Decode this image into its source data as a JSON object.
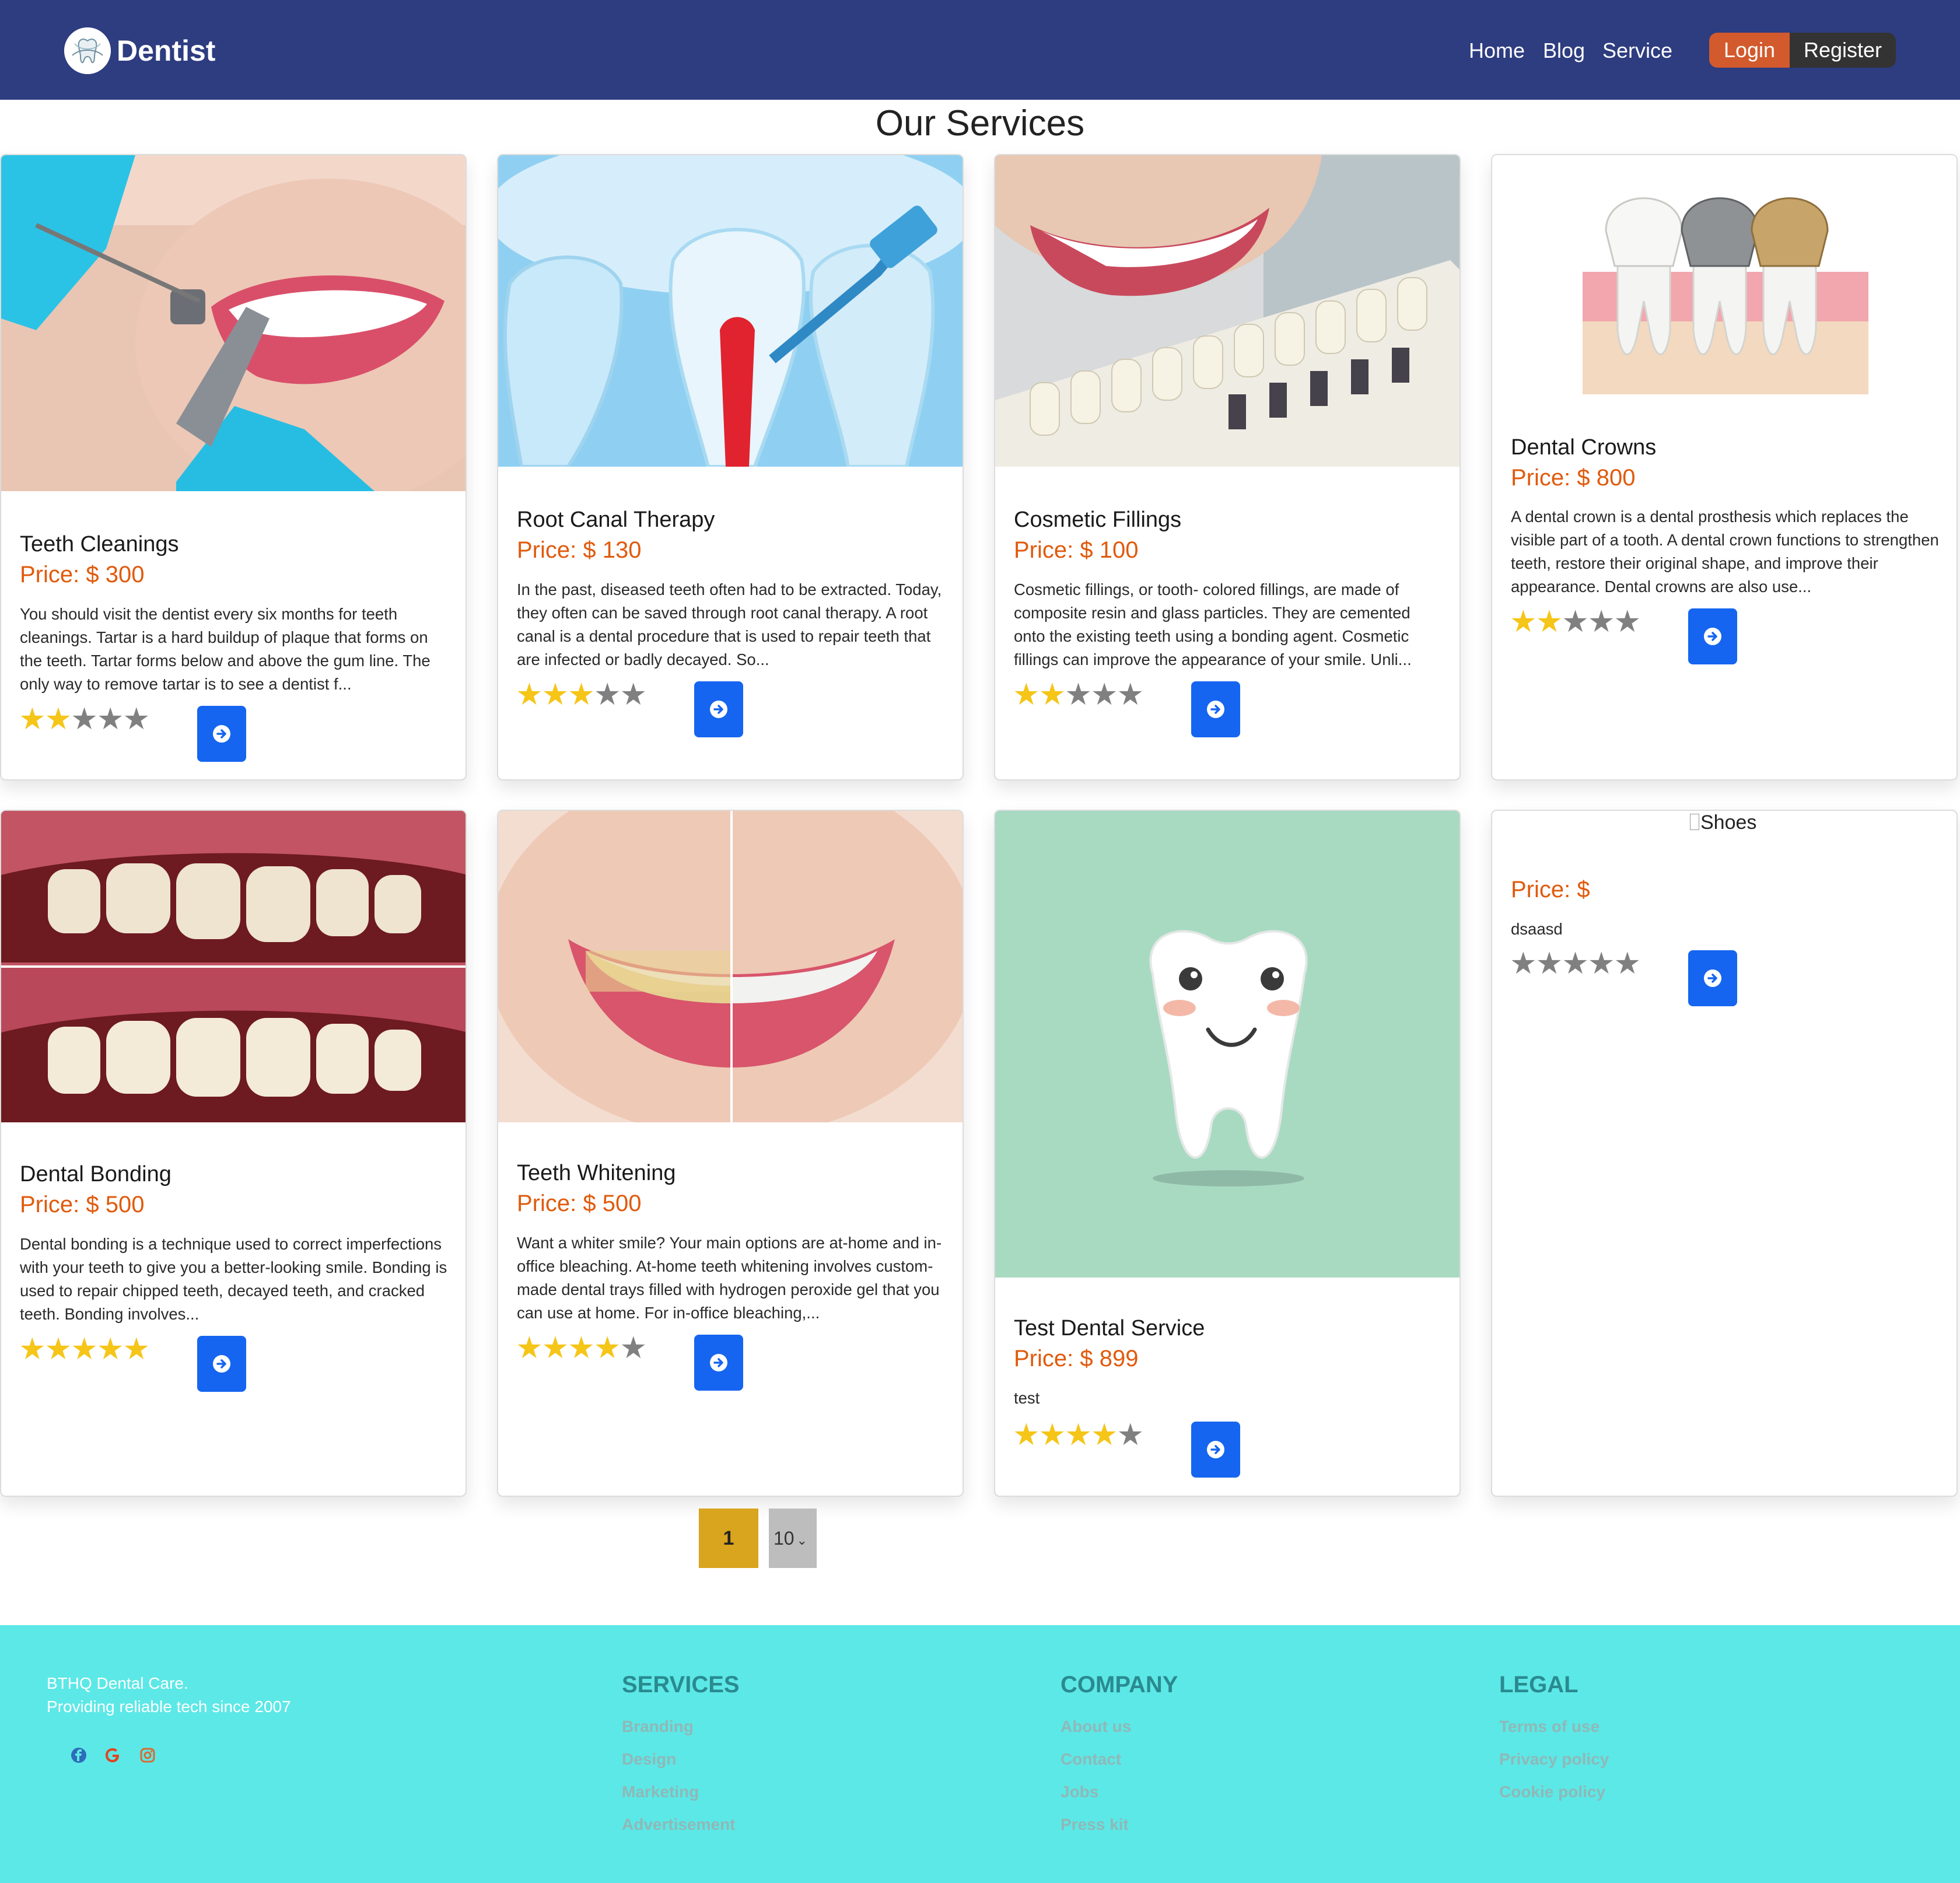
{
  "nav": {
    "brand": "Dentist",
    "links": [
      "Home",
      "Blog",
      "Service"
    ],
    "login": "Login",
    "register": "Register"
  },
  "page_title": "Our Services",
  "cards": [
    {
      "title": "Teeth Cleanings",
      "price": "Price: $ 300",
      "desc": "You should visit the dentist every six months for teeth cleanings. Tartar is a hard buildup of plaque that forms on the teeth. Tartar forms below and above the gum line. The only way to remove tartar is to see a dentist f...",
      "rating": 2,
      "image": "woman smiling during dental cleaning with blue gloves"
    },
    {
      "title": "Root Canal Therapy",
      "price": "Price: $ 130",
      "desc": "In the past, diseased teeth often had to be extracted. Today, they often can be saved through root canal therapy. A root canal is a dental procedure that is used to repair teeth that are infected or badly decayed. So...",
      "rating": 3,
      "image": "blue illustration of root canal treatment"
    },
    {
      "title": "Cosmetic Fillings",
      "price": "Price: $ 100",
      "desc": "Cosmetic fillings, or tooth- colored fillings, are made of composite resin and glass particles. They are cemented onto the existing teeth using a bonding agent. Cosmetic fillings can improve the appearance of your smile. Unli...",
      "rating": 2,
      "image": "smile with tooth shade guide"
    },
    {
      "title": "Dental Crowns",
      "price": "Price: $ 800",
      "desc": "A dental crown is a dental prosthesis which replaces the visible part of a tooth. A dental crown functions to strengthen teeth, restore their original shape, and improve their appearance. Dental crowns are also use...",
      "rating": 2,
      "image": "three dental crowns white silver gold"
    },
    {
      "title": "Dental Bonding",
      "price": "Price: $ 500",
      "desc": "Dental bonding is a technique used to correct imperfections with your teeth to give you a better-looking smile. Bonding is used to repair chipped teeth, decayed teeth, and cracked teeth. Bonding involves...",
      "rating": 5,
      "image": "before and after dental bonding"
    },
    {
      "title": "Teeth Whitening",
      "price": "Price: $ 500",
      "desc": "Want a whiter smile? Your main options are at-home and in-office bleaching. At-home teeth whitening involves custom-made dental trays filled with hydrogen peroxide gel that you can use at home. For in-office bleaching,...",
      "rating": 4,
      "image": "smile before and after whitening"
    },
    {
      "title": "Test Dental Service",
      "price": "Price: $ 899",
      "desc": "test",
      "rating": 4,
      "image": "cartoon smiling tooth on mint background"
    },
    {
      "title": "",
      "price": "Price: $",
      "desc": "dsaasd",
      "rating": 0,
      "image_alt": "Shoes"
    }
  ],
  "pagination": {
    "current": "1",
    "page_size": "10"
  },
  "footer": {
    "tagline_1": "BTHQ Dental Care.",
    "tagline_2": "Providing reliable tech since 2007",
    "social": [
      "facebook-icon",
      "google-icon",
      "instagram-icon"
    ],
    "columns": [
      {
        "heading": "SERVICES",
        "links": [
          "Branding",
          "Design",
          "Marketing",
          "Advertisement"
        ]
      },
      {
        "heading": "COMPANY",
        "links": [
          "About us",
          "Contact",
          "Jobs",
          "Press kit"
        ]
      },
      {
        "heading": "LEGAL",
        "links": [
          "Terms of use",
          "Privacy policy",
          "Cookie policy"
        ]
      }
    ]
  },
  "colors": {
    "navbar": "#2e3c80",
    "price": "#e05a0c",
    "star_on": "#f5c518",
    "star_off": "#808080",
    "button": "#1565f0",
    "login": "#d35a2c",
    "page_active": "#d9a41e",
    "footer": "#5ce8e6"
  }
}
